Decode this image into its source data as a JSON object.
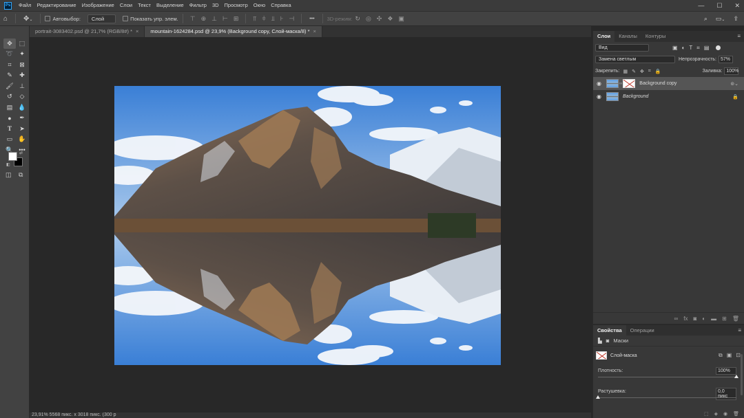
{
  "menu": {
    "logo": "Ps",
    "items": [
      "Файл",
      "Редактирование",
      "Изображение",
      "Слои",
      "Текст",
      "Выделение",
      "Фильтр",
      "3D",
      "Просмотр",
      "Окно",
      "Справка"
    ]
  },
  "window_controls": {
    "minimize": "—",
    "maximize": "☐",
    "close": "✕"
  },
  "options_bar": {
    "autoselect_label": "Автовыбор:",
    "autoselect_value": "Слой",
    "show_controls_label": "Показать упр. элем.",
    "mode_3d_label": "3D-режим:",
    "more": "•••"
  },
  "tabs": [
    {
      "label": "portrait-3083402.psd @ 21,7% (RGB/8#) *",
      "close": "×",
      "active": false
    },
    {
      "label": "mountain-1624284.psd @ 23,9% (Background copy, Слой-маска/8) *",
      "close": "×",
      "active": true
    }
  ],
  "status_bar": {
    "text": "23,91%   5568 пикс. x 3018 пикс. (300 p"
  },
  "layers_panel": {
    "tabs": [
      "Слои",
      "Каналы",
      "Контуры"
    ],
    "filter_value": "Вид",
    "blend_mode": "Замена светлым",
    "opacity_label": "Непрозрачность:",
    "opacity_value": "57%",
    "lock_label": "Закрепить:",
    "fill_label": "Заливка:",
    "fill_value": "100%",
    "layers": [
      {
        "name": "Background copy",
        "selected": true,
        "has_mask": true,
        "italic": false
      },
      {
        "name": "Background",
        "selected": false,
        "has_mask": false,
        "italic": true
      }
    ]
  },
  "properties_panel": {
    "tabs": [
      "Свойства",
      "Операции"
    ],
    "sub_label": "Маски",
    "mask_name": "Слой-маска",
    "density_label": "Плотность:",
    "density_value": "100%",
    "density_level": 1.0,
    "feather_label": "Растушевка:",
    "feather_value": "0,0 пикс",
    "feather_level": 0.0
  },
  "colors": {
    "foreground": "#ffffff",
    "background": "#000000",
    "accent": "#31a8ff"
  }
}
